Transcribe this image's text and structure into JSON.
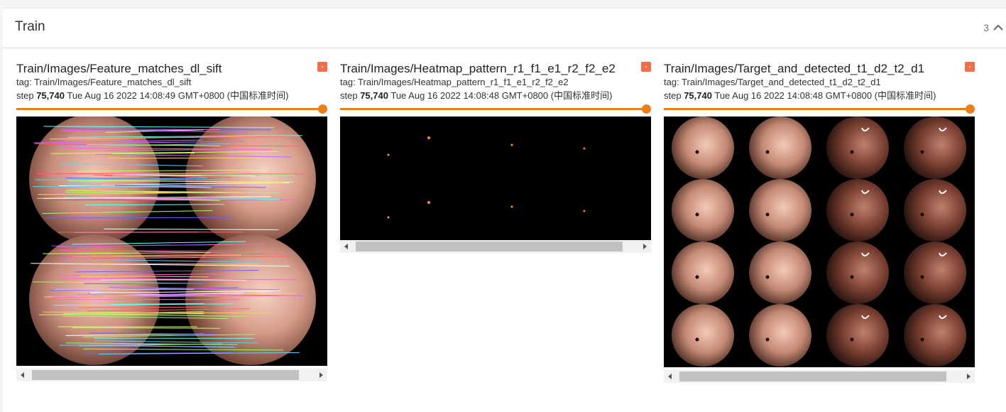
{
  "section": {
    "title": "Train",
    "count": "3"
  },
  "cards": [
    {
      "title": "Train/Images/Feature_matches_dl_sift",
      "tag": "tag: Train/Images/Feature_matches_dl_sift",
      "step_label": "step",
      "step_value": "75,740",
      "timestamp": "Tue Aug 16 2022 14:08:49 GMT+0800 (中国标准时间)"
    },
    {
      "title": "Train/Images/Heatmap_pattern_r1_f1_e1_r2_f2_e2",
      "tag": "tag: Train/Images/Heatmap_pattern_r1_f1_e1_r2_f2_e2",
      "step_label": "step",
      "step_value": "75,740",
      "timestamp": "Tue Aug 16 2022 14:08:48 GMT+0800 (中国标准时间)"
    },
    {
      "title": "Train/Images/Target_and_detected_t1_d2_t2_d1",
      "tag": "tag: Train/Images/Target_and_detected_t1_d2_t2_d1",
      "step_label": "step",
      "step_value": "75,740",
      "timestamp": "Tue Aug 16 2022 14:08:48 GMT+0800 (中国标准时间)"
    }
  ],
  "colors": {
    "accent": "#ef7d1a",
    "pin": "#f26e4b",
    "tissue": "#c98d7c"
  },
  "icons": {
    "collapse": "chevron-up-icon",
    "pin": "pin-icon"
  }
}
